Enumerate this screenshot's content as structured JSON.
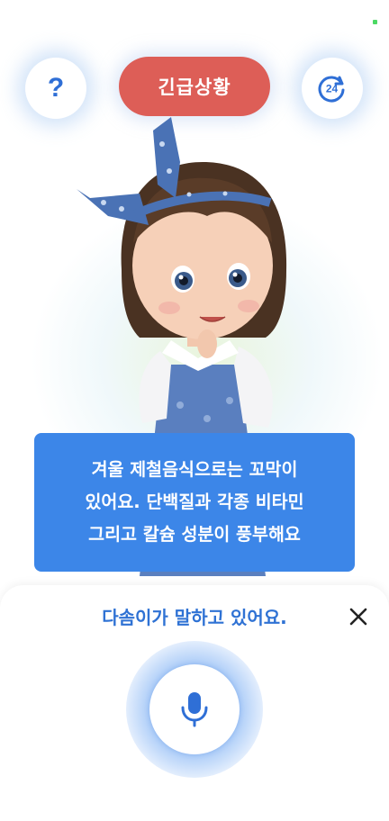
{
  "header": {
    "help_label": "?",
    "emergency_label": "긴급상황",
    "timer_label": "24"
  },
  "speech": {
    "lines": [
      "겨울 제철음식으로는 꼬막이",
      "있어요. 단백질과 각종 비타민",
      "그리고 칼슘 성분이 풍부해요"
    ]
  },
  "sheet": {
    "status_text": "다솜이가 말하고 있어요.",
    "close_icon": "close-icon",
    "mic_icon": "microphone-icon"
  },
  "colors": {
    "accent": "#2f72d4",
    "emergency": "#dd5e57",
    "speech_bg": "#3c86e8"
  }
}
